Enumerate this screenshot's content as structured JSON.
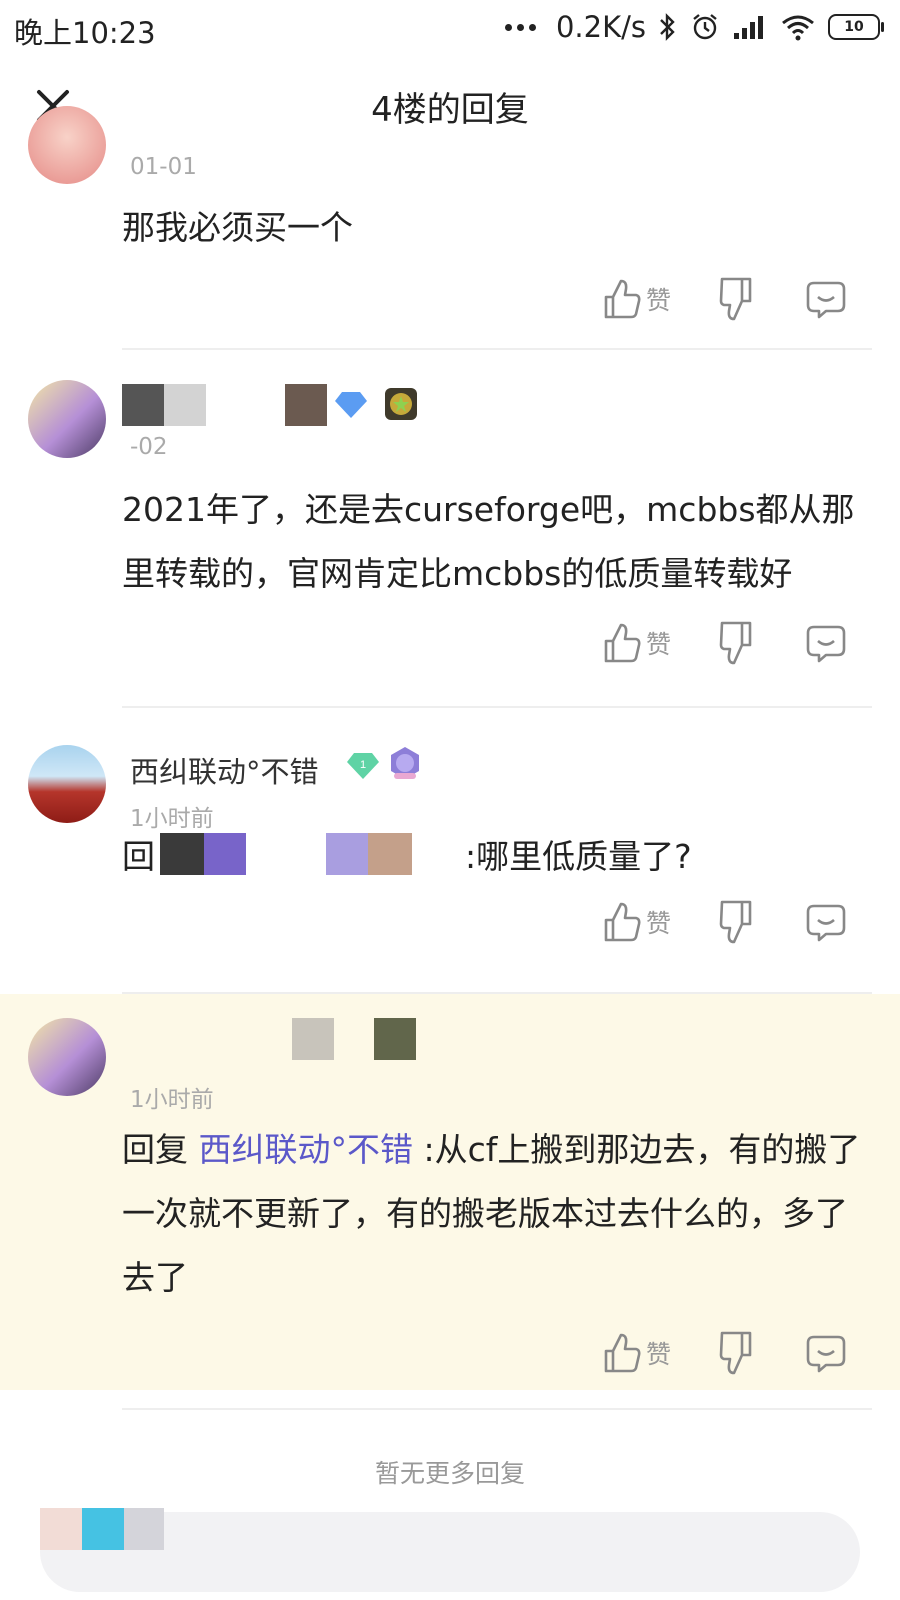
{
  "status": {
    "time": "晚上10:23",
    "speed": "0.2K/s",
    "battery": "10"
  },
  "header": {
    "title": "4楼的回复"
  },
  "actions": {
    "like_label": "赞"
  },
  "posts": [
    {
      "time": "01-01",
      "text": "那我必须买一个"
    },
    {
      "time": "-02",
      "text": "2021年了，还是去curseforge吧，mcbbs都从那里转载的，官网肯定比mcbbs的低质量转载好"
    },
    {
      "name": "西纠联动°不错",
      "level": "1",
      "time": "1小时前",
      "reply_prefix": "回",
      "reply_text": ":哪里低质量了?"
    },
    {
      "time": "1小时前",
      "reply_prefix": "回复",
      "mention": "西纠联动°不错",
      "reply_text": ":从cf上搬到那边去，有的搬了一次就不更新了，有的搬老版本过去什么的，多了去了"
    }
  ],
  "footer": {
    "no_more": "暂无更多回复"
  },
  "colors": {
    "highlight_bg": "#fdf9e7",
    "mention": "#5b58c9",
    "divider": "#eeeeee"
  }
}
